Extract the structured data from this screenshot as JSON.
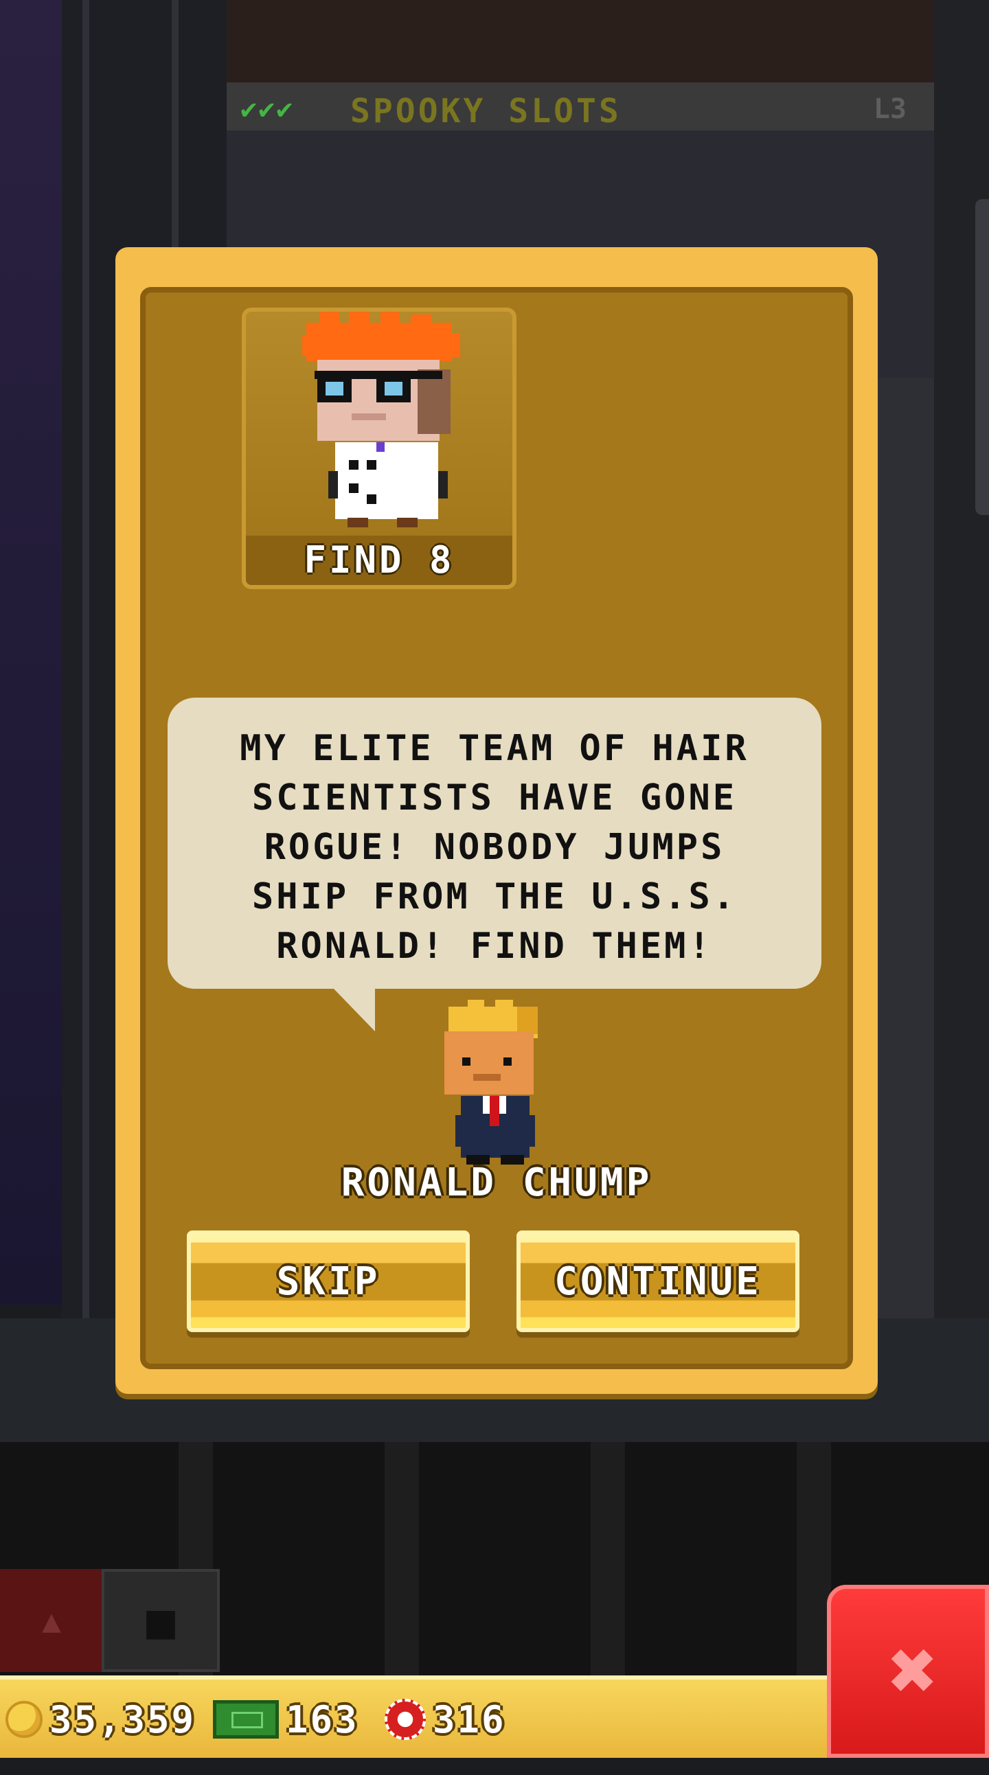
{
  "floor": {
    "checks": "✔✔✔",
    "name": "SPOOKY SLOTS",
    "level": "L3"
  },
  "dialog": {
    "portrait_label": "FIND 8",
    "message": "MY ELITE TEAM OF HAIR SCIENTISTS HAVE GONE ROGUE! NOBODY JUMPS SHIP FROM THE U.S.S. RONALD! FIND THEM!",
    "speaker": "RONALD CHUMP",
    "skip_label": "SKIP",
    "continue_label": "CONTINUE"
  },
  "hud": {
    "coins": "35,359",
    "bux": "163",
    "chips": "316",
    "close_icon": "close-icon"
  },
  "colors": {
    "dialog_outer": "#f5bd4c",
    "dialog_inner": "#a5781b",
    "bubble": "#e6dcc1",
    "close": "#e02424"
  }
}
